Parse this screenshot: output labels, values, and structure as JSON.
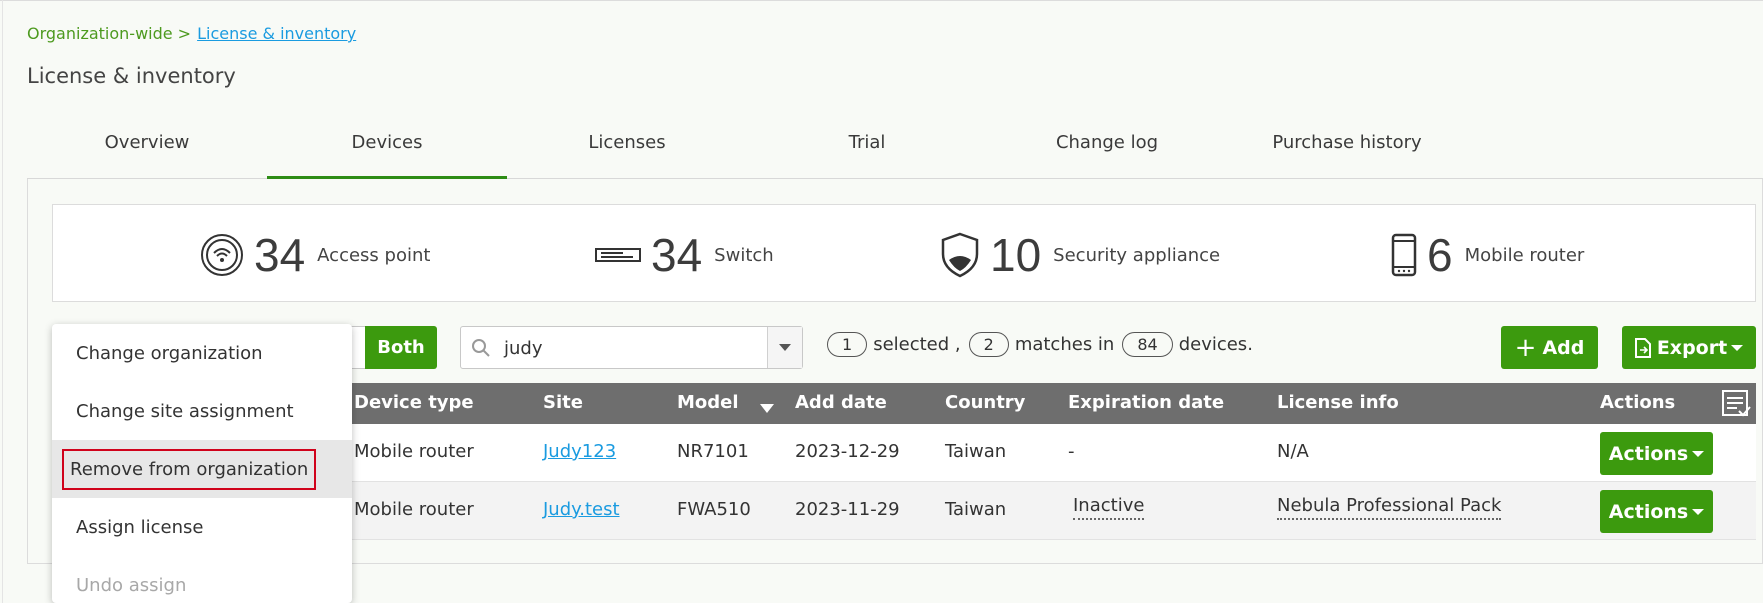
{
  "breadcrumb": {
    "parent": "Organization-wide >",
    "current": "License & inventory"
  },
  "page_title": "License & inventory",
  "tabs": [
    {
      "label": "Overview"
    },
    {
      "label": "Devices",
      "active": true
    },
    {
      "label": "Licenses"
    },
    {
      "label": "Trial"
    },
    {
      "label": "Change log"
    },
    {
      "label": "Purchase history"
    }
  ],
  "summary": [
    {
      "icon": "access-point-icon",
      "count": "34",
      "label": "Access point"
    },
    {
      "icon": "switch-icon",
      "count": "34",
      "label": "Switch"
    },
    {
      "icon": "security-appliance-icon",
      "count": "10",
      "label": "Security appliance"
    },
    {
      "icon": "mobile-router-icon",
      "count": "6",
      "label": "Mobile router"
    }
  ],
  "toolbar": {
    "toggle_label": "Both",
    "search_value": "judy",
    "selected_count": "1",
    "selected_text": "selected ,",
    "matches_count": "2",
    "matches_text": "matches in",
    "devices_count": "84",
    "devices_text": "devices.",
    "add_label": "Add",
    "export_label": "Export"
  },
  "table": {
    "headers": [
      "Device type",
      "Site",
      "Model",
      "Add date",
      "Country",
      "Expiration date",
      "License info",
      "Actions"
    ],
    "rows": [
      {
        "device_type": "Mobile router",
        "site": "Judy123",
        "model": "NR7101",
        "add_date": "2023-12-29",
        "country": "Taiwan",
        "expiration": "-",
        "license_info": "N/A",
        "action": "Actions"
      },
      {
        "device_type": "Mobile router",
        "site": "Judy.test",
        "model": "FWA510",
        "add_date": "2023-11-29",
        "country": "Taiwan",
        "expiration": "Inactive",
        "license_info": "Nebula Professional Pack",
        "action": "Actions"
      }
    ]
  },
  "dropdown": {
    "items": [
      {
        "label": "Change organization"
      },
      {
        "label": "Change site assignment"
      },
      {
        "label": "Remove from organization",
        "highlighted": true
      },
      {
        "label": "Assign license"
      },
      {
        "label": "Undo assign",
        "disabled": true
      }
    ]
  },
  "colors": {
    "accent": "#3c9a0e",
    "link": "#1a9be0",
    "breadcrumb": "#4d9a1f",
    "highlight_border": "#d0021b"
  }
}
